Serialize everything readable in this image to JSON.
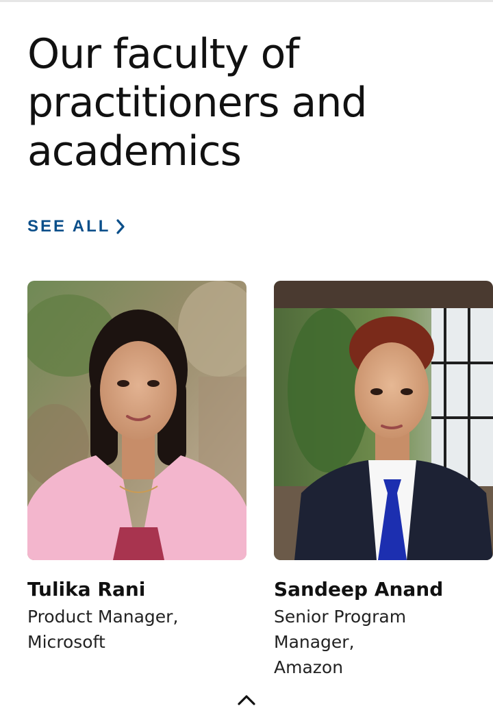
{
  "section": {
    "heading_lines": [
      "Our faculty of",
      "practitioners and",
      "academics"
    ],
    "see_all_label": "SEE ALL"
  },
  "faculty": [
    {
      "name": "Tulika Rani",
      "role_lines": [
        "Product Manager,",
        "Microsoft"
      ]
    },
    {
      "name": "Sandeep Anand",
      "role_lines": [
        "Senior Program",
        "Manager,",
        "Amazon"
      ]
    }
  ],
  "icons": {
    "see_all": "chevron-right-icon",
    "scroll_top": "chevron-up-icon"
  },
  "colors": {
    "accent": "#0b4f8a",
    "text": "#111111"
  }
}
